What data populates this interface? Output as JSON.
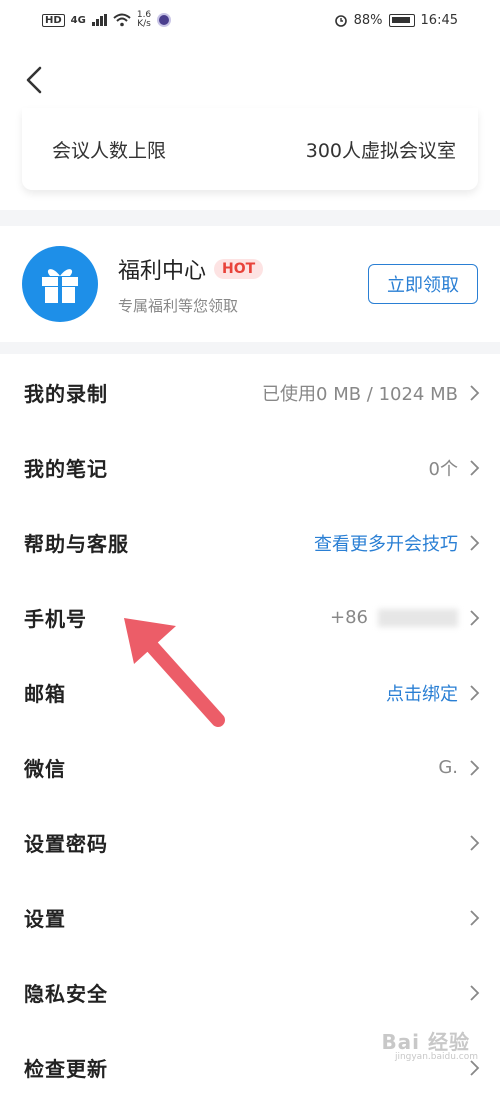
{
  "status": {
    "hd": "HD",
    "network": "4G",
    "speed_value": "1.6",
    "speed_unit": "K/s",
    "battery": "88%",
    "time": "16:45"
  },
  "meeting_limit": {
    "label": "会议人数上限",
    "value": "300人虚拟会议室"
  },
  "welfare": {
    "title": "福利中心",
    "badge": "HOT",
    "subtitle": "专属福利等您领取",
    "button": "立即领取"
  },
  "menu": [
    {
      "label": "我的录制",
      "value": "已使用0 MB / 1024 MB",
      "style": "gray"
    },
    {
      "label": "我的笔记",
      "value": "0个",
      "style": "gray"
    },
    {
      "label": "帮助与客服",
      "value": "查看更多开会技巧",
      "style": "blue"
    },
    {
      "label": "手机号",
      "value": "+86",
      "style": "gray"
    },
    {
      "label": "邮箱",
      "value": "点击绑定",
      "style": "blue"
    },
    {
      "label": "微信",
      "value": "G.",
      "style": "gray"
    },
    {
      "label": "设置密码",
      "value": "",
      "style": "gray"
    },
    {
      "label": "设置",
      "value": "",
      "style": "gray"
    },
    {
      "label": "隐私安全",
      "value": "",
      "style": "gray"
    },
    {
      "label": "检查更新",
      "value": "",
      "style": "gray"
    }
  ],
  "watermark": {
    "text": "Bai 经验",
    "sub": "jingyan.baidu.com"
  },
  "colors": {
    "accent_blue": "#2a7fd4",
    "hot_red": "#e8423a",
    "arrow_red": "#ec5d68",
    "gift_blue": "#1e8fe8"
  }
}
